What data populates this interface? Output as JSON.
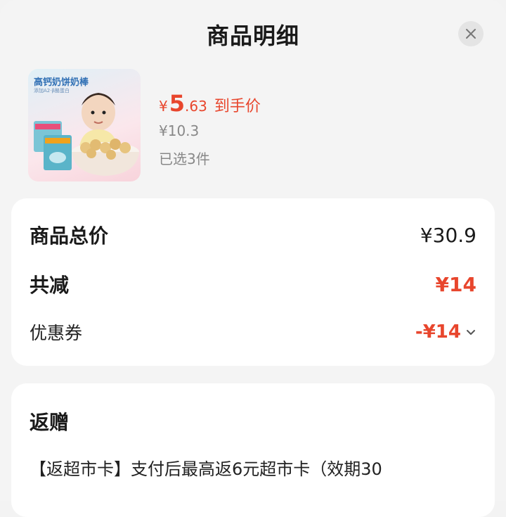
{
  "header": {
    "title": "商品明细"
  },
  "icons": {
    "close": "close-icon",
    "chevron": "chevron-down-icon"
  },
  "product": {
    "image_title": "高钙奶饼奶棒",
    "image_subtitle": "添加A2·β酪蛋白",
    "price_symbol": "¥",
    "price_int": "5",
    "price_dec": ".63",
    "price_tag": "到手价",
    "original_price": "¥10.3",
    "selected_count": "已选3件"
  },
  "summary": {
    "total_label": "商品总价",
    "total_value": "¥30.9",
    "reduce_label": "共减",
    "reduce_value": "¥14",
    "coupon_label": "优惠券",
    "coupon_value": "-¥14"
  },
  "gift": {
    "title": "返赠",
    "text": "【返超市卡】支付后最高返6元超市卡（效期30"
  },
  "colors": {
    "accent": "#e8462d",
    "background": "#f4f4f4",
    "card": "#ffffff"
  }
}
